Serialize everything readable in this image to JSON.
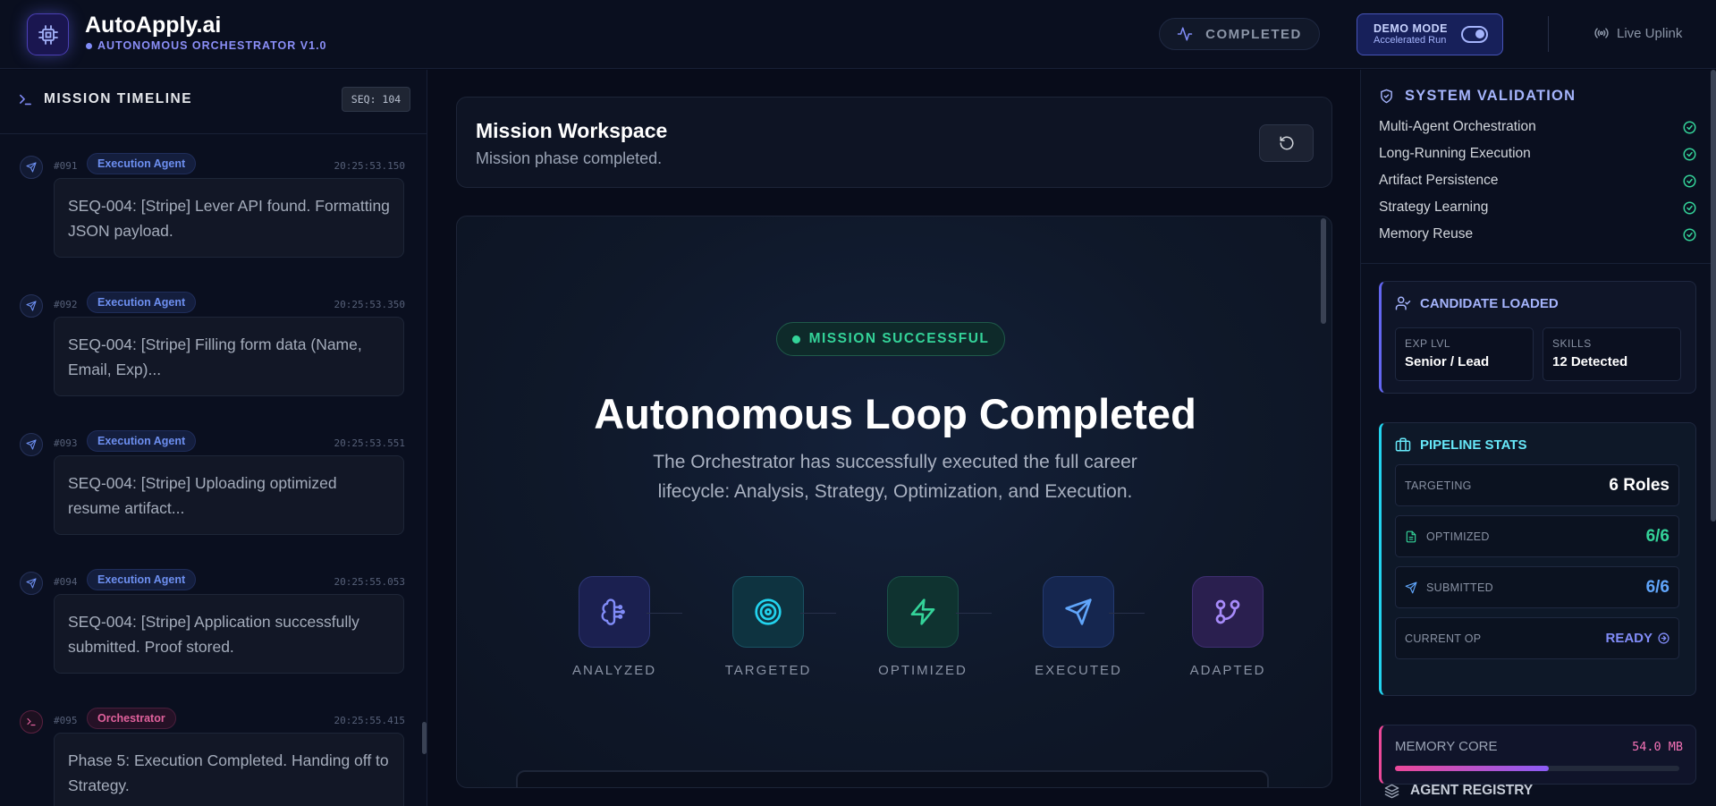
{
  "header": {
    "title": "AutoApply.ai",
    "subtitle": "AUTONOMOUS ORCHESTRATOR V1.0",
    "status": "COMPLETED",
    "demo_title": "DEMO MODE",
    "demo_sub": "Accelerated Run",
    "live": "Live Uplink"
  },
  "timeline": {
    "title": "MISSION TIMELINE",
    "seq": "SEQ: 104",
    "entries": [
      {
        "seq": "#091",
        "agent": "Execution Agent",
        "time": "20:25:53.150",
        "text": "SEQ-004: [Stripe] Lever API found. Formatting JSON payload."
      },
      {
        "seq": "#092",
        "agent": "Execution Agent",
        "time": "20:25:53.350",
        "text": "SEQ-004: [Stripe] Filling form data (Name, Email, Exp)..."
      },
      {
        "seq": "#093",
        "agent": "Execution Agent",
        "time": "20:25:53.551",
        "text": "SEQ-004: [Stripe] Uploading optimized resume artifact..."
      },
      {
        "seq": "#094",
        "agent": "Execution Agent",
        "time": "20:25:55.053",
        "text": "SEQ-004: [Stripe] Application successfully submitted. Proof stored."
      },
      {
        "seq": "#095",
        "agent": "Orchestrator",
        "time": "20:25:55.415",
        "text": "Phase 5: Execution Completed. Handing off to Strategy."
      }
    ]
  },
  "workspace": {
    "title": "Mission Workspace",
    "subtitle": "Mission phase completed."
  },
  "success": {
    "badge": "MISSION SUCCESSFUL",
    "title": "Autonomous Loop Completed",
    "description": "The Orchestrator has successfully executed the full career lifecycle: Analysis, Strategy, Optimization, and Execution.",
    "phases": [
      {
        "label": "ANALYZED",
        "icon": "brain-icon"
      },
      {
        "label": "TARGETED",
        "icon": "target-icon"
      },
      {
        "label": "OPTIMIZED",
        "icon": "zap-icon"
      },
      {
        "label": "EXECUTED",
        "icon": "send-icon"
      },
      {
        "label": "ADAPTED",
        "icon": "git-branch-icon"
      }
    ]
  },
  "validation": {
    "title": "SYSTEM VALIDATION",
    "items": [
      "Multi-Agent Orchestration",
      "Long-Running Execution",
      "Artifact Persistence",
      "Strategy Learning",
      "Memory Reuse"
    ]
  },
  "candidate": {
    "title": "CANDIDATE LOADED",
    "exp_label": "EXP LVL",
    "exp_value": "Senior / Lead",
    "skills_label": "SKILLS",
    "skills_value": "12 Detected"
  },
  "pipeline": {
    "title": "PIPELINE STATS",
    "targeting_label": "TARGETING",
    "targeting_value": "6 Roles",
    "optimized_label": "OPTIMIZED",
    "optimized_value": "6/6",
    "submitted_label": "SUBMITTED",
    "submitted_value": "6/6",
    "current_label": "CURRENT OP",
    "current_value": "READY"
  },
  "memory": {
    "label": "MEMORY CORE",
    "value": "54.0 MB",
    "fill_fraction": 0.54
  },
  "registry": {
    "title": "AGENT REGISTRY"
  },
  "colors": {
    "accent": "#818cf8",
    "success": "#34d399",
    "cyan": "#22d3ee",
    "pink": "#ec4899",
    "blue": "#60a5fa",
    "purple": "#a78bfa"
  }
}
